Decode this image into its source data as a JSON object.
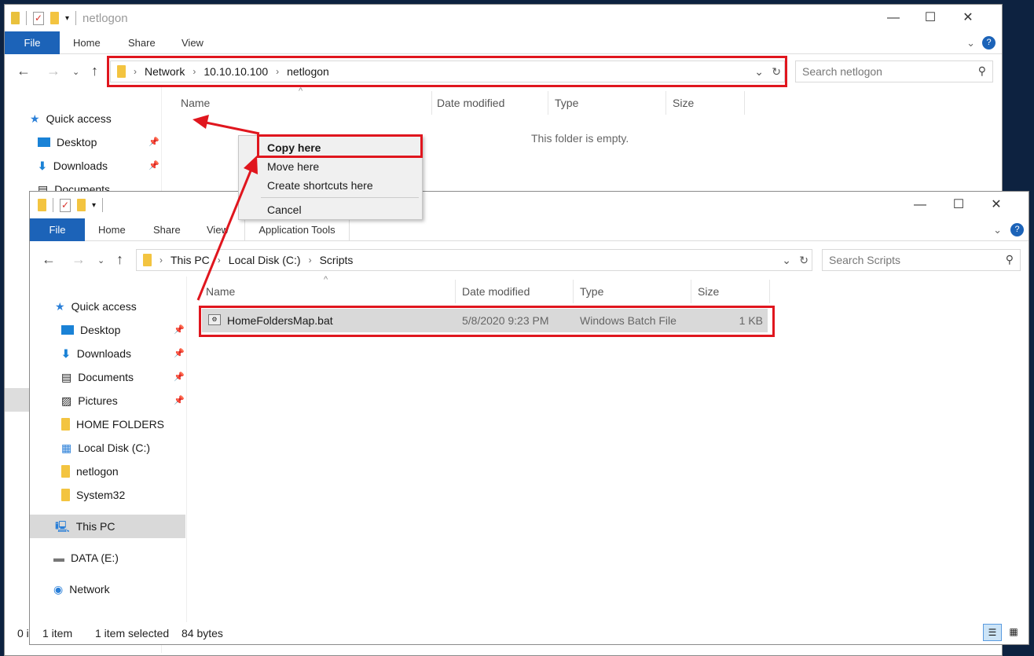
{
  "back": {
    "title": "netlogon",
    "tabs": [
      "File",
      "Home",
      "Share",
      "View"
    ],
    "path": [
      "Network",
      "10.10.10.100",
      "netlogon"
    ],
    "search_placeholder": "Search netlogon",
    "columns": [
      "Name",
      "Date modified",
      "Type",
      "Size"
    ],
    "empty": "This folder is empty.",
    "nav": [
      "Quick access",
      "Desktop",
      "Downloads",
      "Documents"
    ],
    "status": "0 i"
  },
  "context_menu": {
    "items": [
      "Copy here",
      "Move here",
      "Create shortcuts here",
      "Cancel"
    ]
  },
  "front": {
    "tabs": [
      "File",
      "Home",
      "Share",
      "View",
      "Application Tools"
    ],
    "path": [
      "This PC",
      "Local Disk (C:)",
      "Scripts"
    ],
    "search_placeholder": "Search Scripts",
    "columns": [
      "Name",
      "Date modified",
      "Type",
      "Size"
    ],
    "files": [
      {
        "name": "HomeFoldersMap.bat",
        "date": "5/8/2020 9:23 PM",
        "type": "Windows Batch File",
        "size": "1 KB"
      }
    ],
    "nav": [
      "Quick access",
      "Desktop",
      "Downloads",
      "Documents",
      "Pictures",
      "HOME FOLDERS",
      "Local Disk (C:)",
      "netlogon",
      "System32",
      "This PC",
      "DATA (E:)",
      "Network"
    ],
    "status": {
      "count": "1 item",
      "selected": "1 item selected",
      "size": "84 bytes"
    }
  },
  "colors": {
    "accent": "#1c63b8",
    "highlight": "#e0161e"
  }
}
